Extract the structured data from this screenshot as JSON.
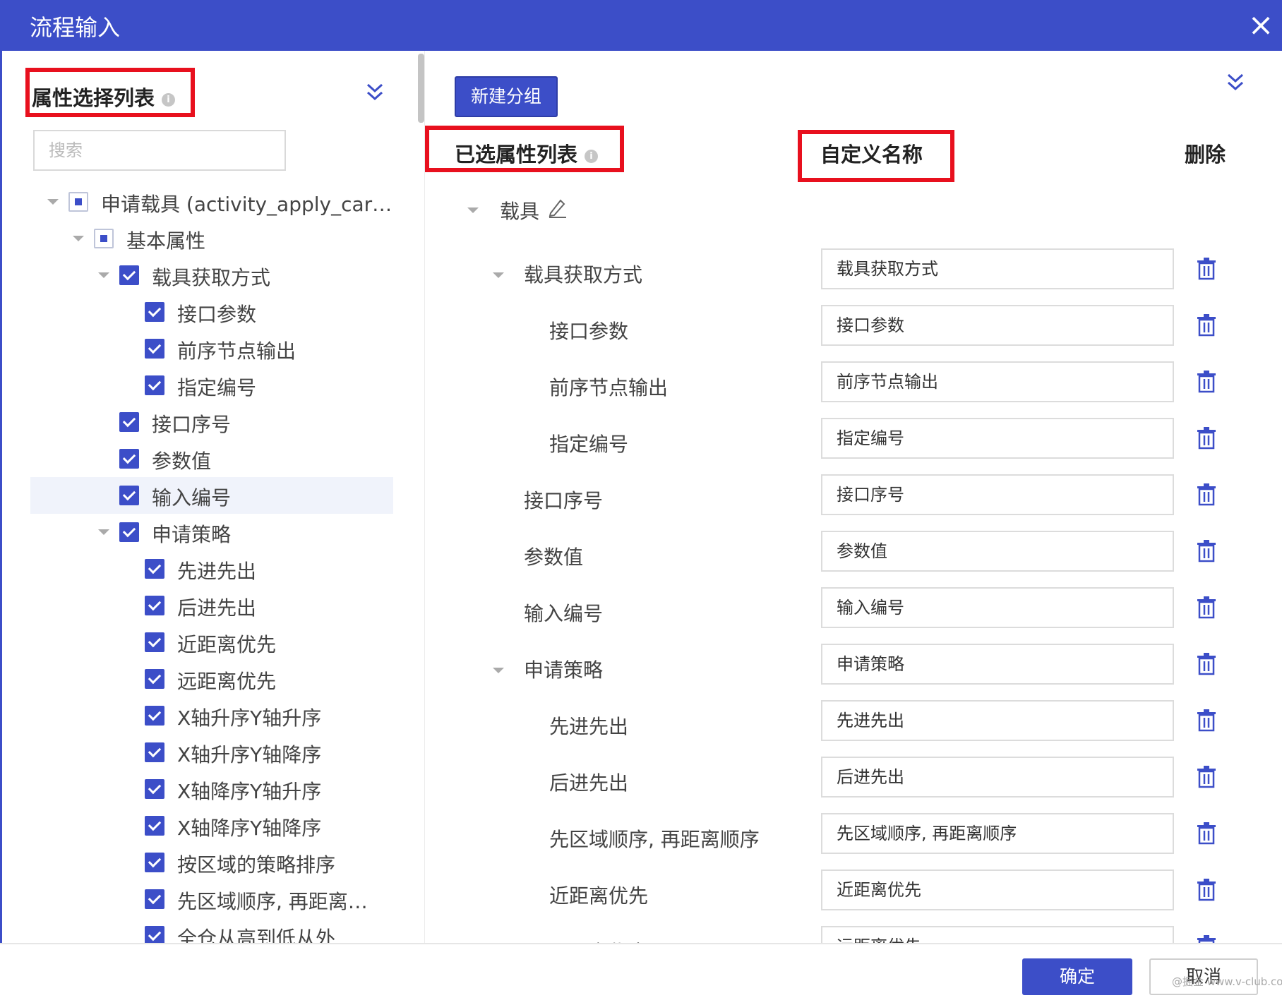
{
  "dialog": {
    "title": "流程输入",
    "close_icon": "×"
  },
  "left": {
    "title": "属性选择列表",
    "search_placeholder": "搜索",
    "tree": [
      {
        "label": "申请载具 (activity_apply_car…",
        "state": "partial",
        "arrow": true,
        "level": 0,
        "highlight": false
      },
      {
        "label": "基本属性",
        "state": "partial",
        "arrow": true,
        "level": 1,
        "highlight": false
      },
      {
        "label": "载具获取方式",
        "state": "checked",
        "arrow": true,
        "level": 2,
        "highlight": false
      },
      {
        "label": "接口参数",
        "state": "checked",
        "arrow": false,
        "level": 3,
        "highlight": false
      },
      {
        "label": "前序节点输出",
        "state": "checked",
        "arrow": false,
        "level": 3,
        "highlight": false
      },
      {
        "label": "指定编号",
        "state": "checked",
        "arrow": false,
        "level": 3,
        "highlight": false
      },
      {
        "label": "接口序号",
        "state": "checked",
        "arrow": false,
        "level": 2,
        "highlight": false
      },
      {
        "label": "参数值",
        "state": "checked",
        "arrow": false,
        "level": 2,
        "highlight": false
      },
      {
        "label": "输入编号",
        "state": "checked",
        "arrow": false,
        "level": 2,
        "highlight": true
      },
      {
        "label": "申请策略",
        "state": "checked",
        "arrow": true,
        "level": 2,
        "highlight": false
      },
      {
        "label": "先进先出",
        "state": "checked",
        "arrow": false,
        "level": 3,
        "highlight": false
      },
      {
        "label": "后进先出",
        "state": "checked",
        "arrow": false,
        "level": 3,
        "highlight": false
      },
      {
        "label": "近距离优先",
        "state": "checked",
        "arrow": false,
        "level": 3,
        "highlight": false
      },
      {
        "label": "远距离优先",
        "state": "checked",
        "arrow": false,
        "level": 3,
        "highlight": false
      },
      {
        "label": "X轴升序Y轴升序",
        "state": "checked",
        "arrow": false,
        "level": 3,
        "highlight": false
      },
      {
        "label": "X轴升序Y轴降序",
        "state": "checked",
        "arrow": false,
        "level": 3,
        "highlight": false
      },
      {
        "label": "X轴降序Y轴升序",
        "state": "checked",
        "arrow": false,
        "level": 3,
        "highlight": false
      },
      {
        "label": "X轴降序Y轴降序",
        "state": "checked",
        "arrow": false,
        "level": 3,
        "highlight": false
      },
      {
        "label": "按区域的策略排序",
        "state": "checked",
        "arrow": false,
        "level": 3,
        "highlight": false
      },
      {
        "label": "先区域顺序, 再距离…",
        "state": "checked",
        "arrow": false,
        "level": 3,
        "highlight": false
      },
      {
        "label": "全仓从高到低从外",
        "state": "checked",
        "arrow": false,
        "level": 3,
        "highlight": false
      }
    ]
  },
  "right": {
    "new_group_label": "新建分组",
    "header_selected": "已选属性列表",
    "header_custom": "自定义名称",
    "header_delete": "删除",
    "group_label": "载具",
    "rows": [
      {
        "label": "载具获取方式",
        "value": "载具获取方式",
        "level": 1,
        "arrow": true
      },
      {
        "label": "接口参数",
        "value": "接口参数",
        "level": 2,
        "arrow": false
      },
      {
        "label": "前序节点输出",
        "value": "前序节点输出",
        "level": 2,
        "arrow": false
      },
      {
        "label": "指定编号",
        "value": "指定编号",
        "level": 2,
        "arrow": false
      },
      {
        "label": "接口序号",
        "value": "接口序号",
        "level": 1,
        "arrow": false
      },
      {
        "label": "参数值",
        "value": "参数值",
        "level": 1,
        "arrow": false
      },
      {
        "label": "输入编号",
        "value": "输入编号",
        "level": 1,
        "arrow": false
      },
      {
        "label": "申请策略",
        "value": "申请策略",
        "level": 1,
        "arrow": true
      },
      {
        "label": "先进先出",
        "value": "先进先出",
        "level": 2,
        "arrow": false
      },
      {
        "label": "后进先出",
        "value": "后进先出",
        "level": 2,
        "arrow": false
      },
      {
        "label": "先区域顺序, 再距离顺序",
        "value": "先区域顺序, 再距离顺序",
        "level": 2,
        "arrow": false
      },
      {
        "label": "近距离优先",
        "value": "近距离优先",
        "level": 2,
        "arrow": false
      },
      {
        "label": "远距离优先",
        "value": "远距离优先",
        "level": 2,
        "arrow": false
      }
    ]
  },
  "footer": {
    "ok_label": "确定",
    "cancel_label": "取消",
    "watermark": "@掘金 www.v-club.com"
  },
  "colors": {
    "primary": "#3c4ec8",
    "annotation": "#e8101e"
  }
}
